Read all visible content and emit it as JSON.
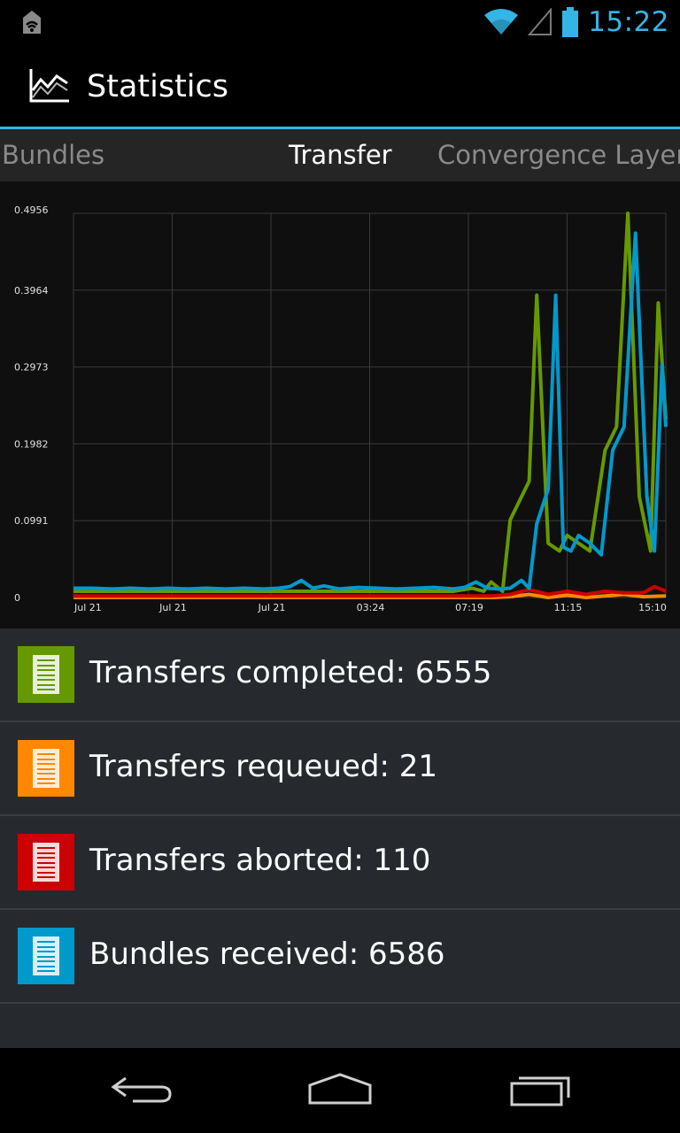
{
  "status_bar": {
    "time": "15:22"
  },
  "action_bar": {
    "title": "Statistics"
  },
  "tabs": [
    {
      "label": "Bundles",
      "active": false
    },
    {
      "label": "Transfer",
      "active": true
    },
    {
      "label": "Convergence Layer",
      "active": false
    }
  ],
  "chart_data": {
    "type": "line",
    "y_ticks": [
      "0.4956",
      "0.3964",
      "0.2973",
      "0.1982",
      "0.0991",
      "0"
    ],
    "ylim": [
      0,
      0.4956
    ],
    "x_ticks": [
      "Jul 21",
      "Jul 21",
      "Jul 21",
      "03:24",
      "07:19",
      "11:15",
      "15:10"
    ],
    "grid": true,
    "series": [
      {
        "name": "Transfers completed",
        "color": "#669900",
        "points": [
          [
            0,
            0.008
          ],
          [
            0.1,
            0.008
          ],
          [
            0.2,
            0.008
          ],
          [
            0.3,
            0.008
          ],
          [
            0.4,
            0.008
          ],
          [
            0.5,
            0.008
          ],
          [
            0.6,
            0.008
          ],
          [
            0.7,
            0.008
          ],
          [
            0.8,
            0.008
          ],
          [
            0.9,
            0.008
          ],
          [
            1.0,
            0.008
          ],
          [
            1.05,
            0.012
          ],
          [
            1.08,
            0.008
          ],
          [
            1.1,
            0.02
          ],
          [
            1.13,
            0.008
          ],
          [
            1.15,
            0.1
          ],
          [
            1.2,
            0.15
          ],
          [
            1.22,
            0.39
          ],
          [
            1.25,
            0.07
          ],
          [
            1.28,
            0.06
          ],
          [
            1.3,
            0.08
          ],
          [
            1.33,
            0.07
          ],
          [
            1.36,
            0.06
          ],
          [
            1.4,
            0.19
          ],
          [
            1.43,
            0.22
          ],
          [
            1.46,
            0.4956
          ],
          [
            1.49,
            0.13
          ],
          [
            1.52,
            0.06
          ],
          [
            1.54,
            0.38
          ],
          [
            1.56,
            0.23
          ]
        ]
      },
      {
        "name": "Transfers requeued",
        "color": "#ff8800",
        "points": [
          [
            0,
            0
          ],
          [
            1.0,
            0
          ],
          [
            1.1,
            0
          ],
          [
            1.15,
            0.001
          ],
          [
            1.2,
            0.004
          ],
          [
            1.25,
            0.0
          ],
          [
            1.3,
            0.003
          ],
          [
            1.35,
            0.0
          ],
          [
            1.4,
            0.002
          ],
          [
            1.45,
            0.004
          ],
          [
            1.5,
            0.001
          ],
          [
            1.56,
            0.002
          ]
        ]
      },
      {
        "name": "Transfers aborted",
        "color": "#cc0000",
        "points": [
          [
            0,
            0.002
          ],
          [
            1.0,
            0.002
          ],
          [
            1.1,
            0.002
          ],
          [
            1.15,
            0.004
          ],
          [
            1.2,
            0.01
          ],
          [
            1.25,
            0.004
          ],
          [
            1.3,
            0.008
          ],
          [
            1.35,
            0.004
          ],
          [
            1.4,
            0.008
          ],
          [
            1.45,
            0.006
          ],
          [
            1.5,
            0.006
          ],
          [
            1.53,
            0.014
          ],
          [
            1.56,
            0.008
          ]
        ]
      },
      {
        "name": "Bundles received",
        "color": "#0099cc",
        "points": [
          [
            0,
            0.012
          ],
          [
            0.05,
            0.012
          ],
          [
            0.1,
            0.011
          ],
          [
            0.15,
            0.012
          ],
          [
            0.2,
            0.011
          ],
          [
            0.25,
            0.012
          ],
          [
            0.3,
            0.011
          ],
          [
            0.35,
            0.012
          ],
          [
            0.4,
            0.011
          ],
          [
            0.45,
            0.012
          ],
          [
            0.5,
            0.011
          ],
          [
            0.54,
            0.012
          ],
          [
            0.57,
            0.014
          ],
          [
            0.6,
            0.022
          ],
          [
            0.63,
            0.012
          ],
          [
            0.66,
            0.015
          ],
          [
            0.7,
            0.011
          ],
          [
            0.75,
            0.013
          ],
          [
            0.8,
            0.012
          ],
          [
            0.85,
            0.011
          ],
          [
            0.9,
            0.012
          ],
          [
            0.95,
            0.013
          ],
          [
            1.0,
            0.011
          ],
          [
            1.03,
            0.013
          ],
          [
            1.06,
            0.02
          ],
          [
            1.09,
            0.012
          ],
          [
            1.12,
            0.011
          ],
          [
            1.15,
            0.012
          ],
          [
            1.18,
            0.022
          ],
          [
            1.2,
            0.012
          ],
          [
            1.22,
            0.095
          ],
          [
            1.25,
            0.14
          ],
          [
            1.27,
            0.39
          ],
          [
            1.29,
            0.065
          ],
          [
            1.31,
            0.06
          ],
          [
            1.33,
            0.08
          ],
          [
            1.36,
            0.07
          ],
          [
            1.39,
            0.055
          ],
          [
            1.42,
            0.19
          ],
          [
            1.45,
            0.22
          ],
          [
            1.48,
            0.47
          ],
          [
            1.51,
            0.13
          ],
          [
            1.53,
            0.06
          ],
          [
            1.55,
            0.3
          ],
          [
            1.56,
            0.22
          ]
        ]
      }
    ]
  },
  "legend": [
    {
      "label": "Transfers completed: 6555",
      "color": "#669900",
      "line_color": "#669900"
    },
    {
      "label": "Transfers requeued: 21",
      "color": "#ff8800",
      "line_color": "#ff8800"
    },
    {
      "label": "Transfers aborted: 110",
      "color": "#cc0000",
      "line_color": "#cc0000"
    },
    {
      "label": "Bundles received: 6586",
      "color": "#0099cc",
      "line_color": "#0099cc"
    }
  ],
  "nav": {
    "back": "back-icon",
    "home": "home-icon",
    "recents": "recents-icon"
  }
}
